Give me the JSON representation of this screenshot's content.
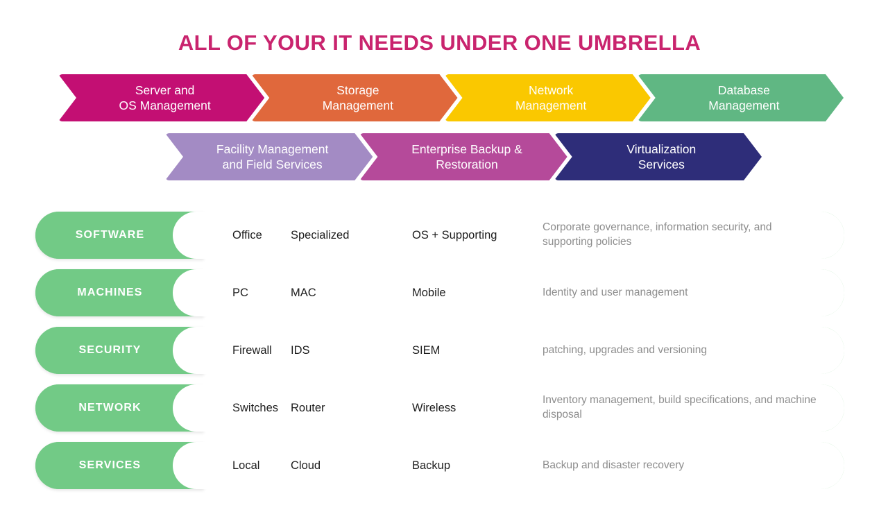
{
  "title": "ALL OF YOUR IT NEEDS UNDER ONE UMBRELLA",
  "colors": {
    "title": "#c9246e",
    "green_tag": "#72ca86",
    "row_border": "#a8e0ae",
    "cell_text": "#1d1d1d",
    "note_text": "#8d8d8d"
  },
  "chevron_rows": [
    {
      "items": [
        {
          "line1": "Server and",
          "line2": "OS Management",
          "color": "#c30f73"
        },
        {
          "line1": "Storage",
          "line2": "Management",
          "color": "#e0683c"
        },
        {
          "line1": "Network",
          "line2": "Management",
          "color": "#fac800"
        },
        {
          "line1": "Database",
          "line2": "Management",
          "color": "#60b783"
        }
      ]
    },
    {
      "items": [
        {
          "line1": "Facility Management",
          "line2": "and Field Services",
          "color": "#a38bc4"
        },
        {
          "line1": "Enterprise Backup &",
          "line2": "Restoration",
          "color": "#b54a9a"
        },
        {
          "line1": "Virtualization",
          "line2": "Services",
          "color": "#2e2d79"
        }
      ]
    }
  ],
  "table_rows": [
    {
      "tag": "SOFTWARE",
      "c1": "Office",
      "c2": "Specialized",
      "c3": "OS + Supporting",
      "note": "Corporate governance, information security, and supporting policies"
    },
    {
      "tag": "MACHINES",
      "c1": "PC",
      "c2": "MAC",
      "c3": "Mobile",
      "note": "Identity and user management"
    },
    {
      "tag": "SECURITY",
      "c1": "Firewall",
      "c2": "IDS",
      "c3": "SIEM",
      "note": "patching, upgrades and versioning"
    },
    {
      "tag": "NETWORK",
      "c1": "Switches",
      "c2": "Router",
      "c3": "Wireless",
      "note": "Inventory management, build specifications, and machine disposal"
    },
    {
      "tag": "SERVICES",
      "c1": "Local",
      "c2": "Cloud",
      "c3": "Backup",
      "note": "Backup and disaster recovery"
    }
  ]
}
